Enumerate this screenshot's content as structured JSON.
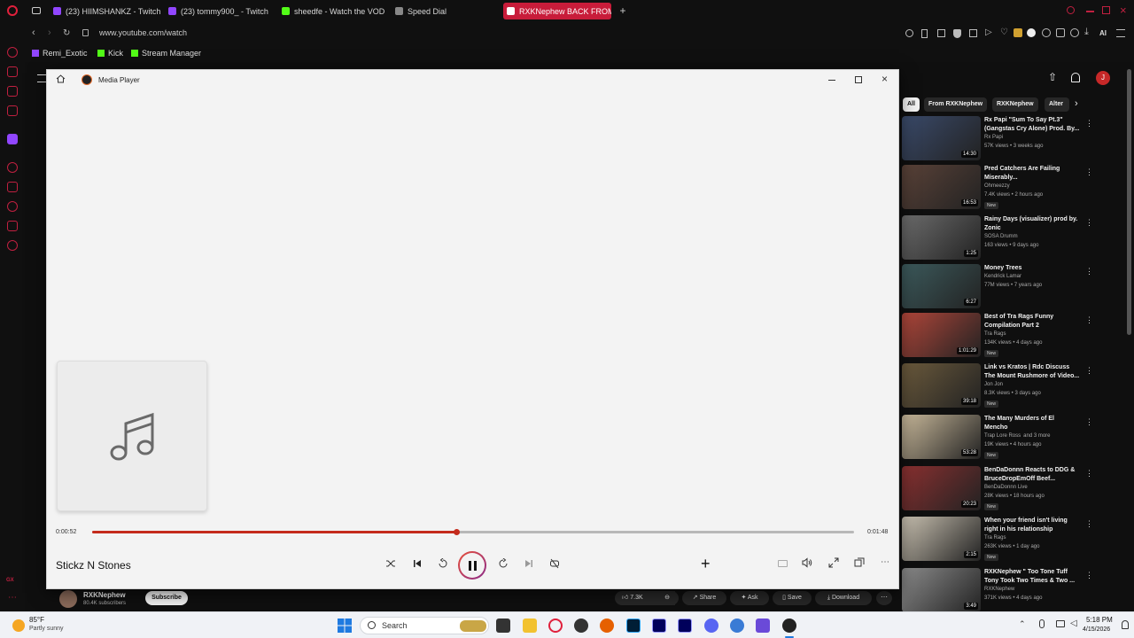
{
  "browser": {
    "tabs": [
      {
        "label": "(23) HIIMSHANKZ - Twitch",
        "color": "#9146ff"
      },
      {
        "label": "(23) tommy900_ - Twitch",
        "color": "#9146ff"
      },
      {
        "label": "sheedfe - Watch the VOD",
        "color": "#53fc18"
      },
      {
        "label": "Speed Dial",
        "color": "#888888"
      },
      {
        "label": "RXKNephew BACK FROM",
        "color": "#ffffff"
      }
    ],
    "url": "www.youtube.com/watch",
    "bookmarks": [
      "Remi_Exotic",
      "Kick",
      "Stream Manager"
    ],
    "ai_label": "AI",
    "sidebar_badge": "GX"
  },
  "media_player": {
    "window_title": "Media Player",
    "elapsed": "0:00:52",
    "total": "0:01:48",
    "progress_fraction": 0.478,
    "track_title": "Stickz N Stones",
    "accent": "#c42b1c"
  },
  "youtube": {
    "chips": [
      "All",
      "From RXKNephew",
      "RXKNephew",
      "Alter"
    ],
    "recommendations": [
      {
        "title_lines": [
          "Rx Papi \"Sum To Say Pt.3\"",
          "(Gangstas Cry Alone) Prod. By..."
        ],
        "channel": "Rx Papi",
        "meta": "57K views • 3 weeks ago",
        "duration": "14:30",
        "new": "",
        "thumb": "#3a4a6a"
      },
      {
        "title_lines": [
          "Pred Catchers Are Failing",
          "Miserably..."
        ],
        "channel": "Ohmeezzy",
        "meta": "7.4K views • 2 hours ago",
        "duration": "16:53",
        "new": "New",
        "thumb": "#5a4238"
      },
      {
        "title_lines": [
          "Rainy Days (visualizer) prod by.",
          "Zonic"
        ],
        "channel": "SOSA Drumm",
        "meta": "163 views • 9 days ago",
        "duration": "1:25",
        "new": "",
        "thumb": "#6c6c6c"
      },
      {
        "title_lines": [
          "Money Trees"
        ],
        "channel": "Kendrick Lamar",
        "meta": "77M views • 7 years ago",
        "duration": "6:27",
        "new": "",
        "thumb": "#3c5a5c"
      },
      {
        "title_lines": [
          "Best of Tra Rags Funny",
          "Compilation Part 2"
        ],
        "channel": "Tra Rags",
        "meta": "134K views • 4 days ago",
        "duration": "1:01:29",
        "new": "New",
        "thumb": "#b0463a"
      },
      {
        "title_lines": [
          "Link vs Kratos | Rdc Discuss",
          "The Mount Rushmore of Video..."
        ],
        "channel": "Jon Jon",
        "meta": "8.3K views • 3 days ago",
        "duration": "39:18",
        "new": "New",
        "thumb": "#6b5a3c"
      },
      {
        "title_lines": [
          "The Many Murders of El",
          "Mencho"
        ],
        "channel": "Trap Lore Ross",
        "channel_extra": "and 3 more",
        "meta": "19K views • 4 hours ago",
        "duration": "53:28",
        "new": "New",
        "thumb": "#c8b89a"
      },
      {
        "title_lines": [
          "BenDaDonnn Reacts to DDG &",
          "BruceDropEmOff Beef..."
        ],
        "channel": "BenDaDonnn Live",
        "meta": "28K views • 18 hours ago",
        "duration": "20:23",
        "new": "New",
        "thumb": "#8a3030"
      },
      {
        "title_lines": [
          "When your friend isn't living",
          "right in his relationship"
        ],
        "channel": "Tra Rags",
        "meta": "263K views • 1 day ago",
        "duration": "2:15",
        "new": "New",
        "thumb": "#c8c0b0"
      },
      {
        "title_lines": [
          "RXKNephew \" Too Tone Tuff",
          "Tony Took Two Times & Two ..."
        ],
        "channel": "RXKNephew",
        "meta": "371K views • 4 days ago",
        "duration": "3:49",
        "new": "",
        "thumb": "#8a8a8a"
      }
    ],
    "channel": {
      "name": "RXKNephew",
      "subs": "80.4K subscribers",
      "subscribe": "Subscribe"
    },
    "actions": {
      "likes": "7.3K",
      "share": "Share",
      "ask": "Ask",
      "save": "Save",
      "download": "Download"
    }
  },
  "taskbar": {
    "weather_temp": "85°F",
    "weather_desc": "Partly sunny",
    "search_placeholder": "Search",
    "time": "5:18 PM",
    "date": "4/15/2026"
  }
}
